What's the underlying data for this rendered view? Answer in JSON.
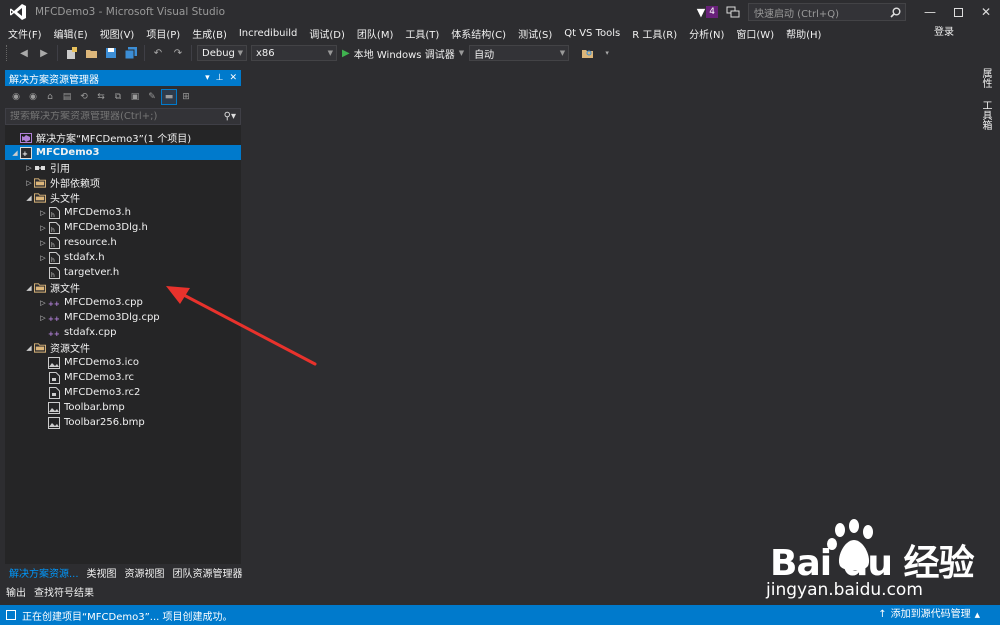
{
  "window": {
    "title": "MFCDemo3 - Microsoft Visual Studio",
    "notifications_count": "4",
    "quick_launch_placeholder": "快速启动 (Ctrl+Q)"
  },
  "menu": [
    "文件(F)",
    "编辑(E)",
    "视图(V)",
    "项目(P)",
    "生成(B)",
    "Incredibuild",
    "调试(D)",
    "团队(M)",
    "工具(T)",
    "体系结构(C)",
    "测试(S)",
    "Qt VS Tools",
    "R 工具(R)",
    "分析(N)",
    "窗口(W)",
    "帮助(H)"
  ],
  "signin": "登录",
  "toolbar": {
    "config": "Debug",
    "platform": "x86",
    "run_label": "本地 Windows 调试器",
    "auto": "自动"
  },
  "solution_explorer": {
    "title": "解决方案资源管理器",
    "search_placeholder": "搜索解决方案资源管理器(Ctrl+;)",
    "tree": [
      {
        "label": "解决方案“MFCDemo3”(1 个项目)",
        "indent": 0,
        "twisty": "",
        "icon": "solution"
      },
      {
        "label": "MFCDemo3",
        "indent": 0,
        "twisty": "open",
        "icon": "project",
        "selected": true
      },
      {
        "label": "引用",
        "indent": 1,
        "twisty": "closed",
        "icon": "references"
      },
      {
        "label": "外部依赖项",
        "indent": 1,
        "twisty": "closed",
        "icon": "folder"
      },
      {
        "label": "头文件",
        "indent": 1,
        "twisty": "open",
        "icon": "folder"
      },
      {
        "label": "MFCDemo3.h",
        "indent": 2,
        "twisty": "closed",
        "icon": "header"
      },
      {
        "label": "MFCDemo3Dlg.h",
        "indent": 2,
        "twisty": "closed",
        "icon": "header"
      },
      {
        "label": "resource.h",
        "indent": 2,
        "twisty": "closed",
        "icon": "header"
      },
      {
        "label": "stdafx.h",
        "indent": 2,
        "twisty": "closed",
        "icon": "header"
      },
      {
        "label": "targetver.h",
        "indent": 2,
        "twisty": "",
        "icon": "header"
      },
      {
        "label": "源文件",
        "indent": 1,
        "twisty": "open",
        "icon": "folder"
      },
      {
        "label": "MFCDemo3.cpp",
        "indent": 2,
        "twisty": "closed",
        "icon": "cpp"
      },
      {
        "label": "MFCDemo3Dlg.cpp",
        "indent": 2,
        "twisty": "closed",
        "icon": "cpp"
      },
      {
        "label": "stdafx.cpp",
        "indent": 2,
        "twisty": "",
        "icon": "cpp"
      },
      {
        "label": "资源文件",
        "indent": 1,
        "twisty": "open",
        "icon": "folder"
      },
      {
        "label": "MFCDemo3.ico",
        "indent": 2,
        "twisty": "",
        "icon": "image"
      },
      {
        "label": "MFCDemo3.rc",
        "indent": 2,
        "twisty": "",
        "icon": "resource"
      },
      {
        "label": "MFCDemo3.rc2",
        "indent": 2,
        "twisty": "",
        "icon": "resource"
      },
      {
        "label": "Toolbar.bmp",
        "indent": 2,
        "twisty": "",
        "icon": "image"
      },
      {
        "label": "Toolbar256.bmp",
        "indent": 2,
        "twisty": "",
        "icon": "image"
      }
    ],
    "tabs": [
      "解决方案资源...",
      "类视图",
      "资源视图",
      "团队资源管理器"
    ]
  },
  "bottom_tabs": [
    "输出",
    "查找符号结果"
  ],
  "right_tabs": [
    "属性",
    "工具箱"
  ],
  "status": {
    "message": "正在创建项目“MFCDemo3”... 项目创建成功。",
    "source_control": "添加到源代码管理"
  },
  "watermark": {
    "logo_text": "Bai du 经验",
    "url": "jingyan.baidu.com"
  },
  "colors": {
    "accent": "#007acc",
    "background": "#2d2d30",
    "panel": "#252526",
    "arrow": "#e8322c"
  }
}
